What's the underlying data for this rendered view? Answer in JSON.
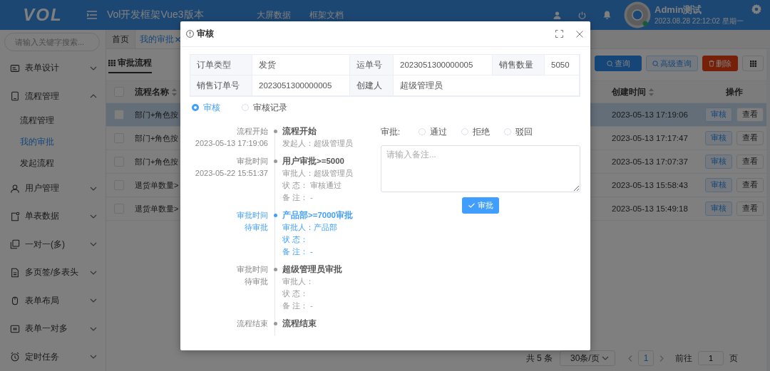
{
  "header": {
    "logo": "VOL",
    "title": "Vol开发框架Vue3版本",
    "links": [
      "大屏数据",
      "框架文档"
    ],
    "user": {
      "name": "Admin测试",
      "datetime": "2023.08.28 22:12:02 星期一"
    }
  },
  "sidebar": {
    "search": {
      "placeholder": "请输入关键字搜索..."
    },
    "items": [
      {
        "label": "表单设计",
        "expanded": false
      },
      {
        "label": "流程管理",
        "expanded": true,
        "children": [
          {
            "label": "流程管理",
            "selected": false
          },
          {
            "label": "我的审批",
            "selected": true
          },
          {
            "label": "发起流程",
            "selected": false
          }
        ]
      },
      {
        "label": "用户管理",
        "expanded": false
      },
      {
        "label": "单表数据",
        "expanded": false
      },
      {
        "label": "一对一(多)",
        "expanded": false
      },
      {
        "label": "多页签/多表头",
        "expanded": false
      },
      {
        "label": "表单布局",
        "expanded": false
      },
      {
        "label": "表单一对多",
        "expanded": false
      },
      {
        "label": "定时任务",
        "expanded": false
      }
    ]
  },
  "page_tabs": [
    {
      "label": "首页",
      "selected": false,
      "closable": false
    },
    {
      "label": "我的审批",
      "selected": true,
      "closable": true
    }
  ],
  "section_title": "审批流程",
  "toolbar": [
    {
      "label": "查询",
      "kind": "primary"
    },
    {
      "label": "高级查询",
      "kind": "plain"
    },
    {
      "label": "删除",
      "kind": "danger"
    },
    {
      "kind": "grid"
    }
  ],
  "table": {
    "columns": [
      "流程名称",
      "创建时间",
      "操作"
    ],
    "all_checked": false,
    "rows": [
      {
        "name": "部门+角色按",
        "created": "2023-05-13 17:19:06",
        "selected": true,
        "checked": false,
        "actions": [
          "审核",
          "查看"
        ]
      },
      {
        "name": "部门+角色按",
        "created": "2023-05-13 17:17:47",
        "selected": false,
        "checked": false,
        "actions": [
          "审核",
          "查看"
        ]
      },
      {
        "name": "部门+角色按",
        "created": "2023-05-13 17:07:37",
        "selected": false,
        "checked": false,
        "actions": [
          "审核",
          "查看"
        ]
      },
      {
        "name": "退货单数量>",
        "created": "2023-05-13 15:58:43",
        "selected": false,
        "checked": false,
        "actions": [
          "审核",
          "查看"
        ]
      },
      {
        "name": "退货单数量>",
        "created": "2023-05-13 15:49:18",
        "selected": false,
        "checked": false,
        "actions": [
          "审核",
          "查看"
        ]
      }
    ]
  },
  "pagination": {
    "total": "共 5 条",
    "page_size": "30条/页",
    "pages": [
      {
        "label": "1",
        "selected": true
      }
    ],
    "goto_label": "前往",
    "goto_value": "1",
    "page_unit": "页"
  },
  "dialog": {
    "title": "审核",
    "info": [
      [
        {
          "label": "订单类型",
          "value": "发货"
        },
        {
          "label": "运单号",
          "value": "2023051300000005"
        },
        {
          "label": "销售数量",
          "value": "5050"
        }
      ],
      [
        {
          "label": "销售订单号",
          "value": "2023051300000005"
        },
        {
          "label": "创建人",
          "value": "超级管理员"
        }
      ]
    ],
    "view_tabs": [
      {
        "label": "审核",
        "selected": true
      },
      {
        "label": "审核记录",
        "selected": false
      }
    ],
    "timeline": [
      {
        "left": [
          "流程开始",
          "2023-05-13 17:19:06"
        ],
        "title": "流程开始",
        "lines": [
          "发起人：超级管理员"
        ],
        "current": false
      },
      {
        "left": [
          "审批时间",
          "2023-05-22 15:51:37"
        ],
        "title": "用户审批>=5000",
        "lines": [
          "审批人：超级管理员",
          "状 态： 审核通过",
          "备 注： -"
        ],
        "current": false
      },
      {
        "left": [
          "审批时间",
          "待审批"
        ],
        "title": "产品部>=7000审批",
        "lines": [
          "审批人：产品部",
          "状 态：",
          "备 注： -"
        ],
        "current": true
      },
      {
        "left": [
          "审批时间",
          "待审批"
        ],
        "title": "超级管理员审批",
        "lines": [
          "审批人：",
          "状 态：",
          "备 注： -"
        ],
        "current": false
      },
      {
        "left": [
          "流程结束"
        ],
        "title": "流程结束",
        "current": false
      }
    ],
    "decision": {
      "label": "审批:",
      "options": [
        {
          "label": "通过",
          "selected": false
        },
        {
          "label": "拒绝",
          "selected": false
        },
        {
          "label": "驳回",
          "selected": false
        }
      ],
      "remark": {
        "placeholder": "请输入备注..."
      },
      "submit": "审批"
    }
  }
}
